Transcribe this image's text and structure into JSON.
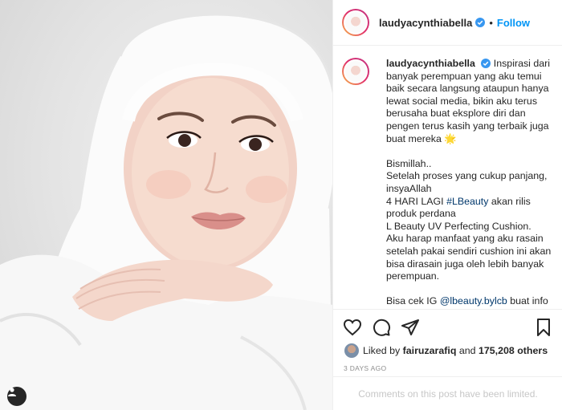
{
  "post": {
    "username": "laudyacynthiabella",
    "dot": "•",
    "follow_label": "Follow",
    "caption": {
      "username": "laudyacynthiabella",
      "p1": "Inspirasi dari banyak perempuan yang aku temui baik secara langsung ataupun hanya lewat social media, bikin aku terus berusaha buat eksplore diri dan pengen terus kasih yang terbaik juga buat mereka",
      "p1_emoji": "🌟",
      "line_bismillah": "Bismillah..",
      "line2": "Setelah proses yang cukup panjang, insyaAllah",
      "line3_pre": "4 HARI LAGI",
      "line3_tag": "#LBeauty",
      "line3_post": "akan rilis produk perdana",
      "line4": "L Beauty UV Perfecting Cushion.",
      "line5": "Aku harap manfaat yang aku rasain setelah pakai sendiri cushion ini akan bisa dirasain juga oleh lebih banyak perempuan.",
      "line6_pre": "Bisa cek IG",
      "line6_tag": "@lbeauty.bylcb",
      "line6_post": "buat info"
    },
    "likes": {
      "prefix": "Liked by",
      "user": "fairuzarafiq",
      "and": "and",
      "count": "175,208 others"
    },
    "timestamp": "3 DAYS AGO",
    "comments_limited": "Comments on this post have been limited."
  },
  "icons": {
    "like": "heart-icon",
    "comment": "comment-icon",
    "share": "share-icon",
    "save": "bookmark-icon",
    "tag": "user-tag-icon",
    "verified": "verified-badge-icon"
  },
  "colors": {
    "link": "#00376b",
    "follow": "#0095f6",
    "verified": "#3897f0",
    "muted": "#8e8e8e"
  }
}
